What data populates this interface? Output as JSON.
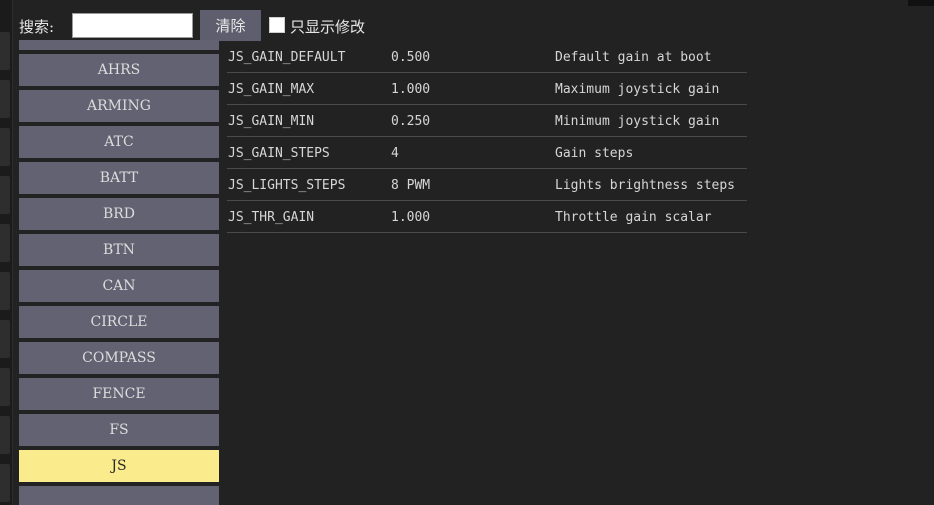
{
  "toolbar": {
    "search_label": "搜索:",
    "search_value": "",
    "clear_label": "清除",
    "only_modified_label": "只显示修改",
    "only_modified_checked": false
  },
  "sidebar": {
    "items": [
      {
        "label": "AHRS",
        "selected": false
      },
      {
        "label": "ARMING",
        "selected": false
      },
      {
        "label": "ATC",
        "selected": false
      },
      {
        "label": "BATT",
        "selected": false
      },
      {
        "label": "BRD",
        "selected": false
      },
      {
        "label": "BTN",
        "selected": false
      },
      {
        "label": "CAN",
        "selected": false
      },
      {
        "label": "CIRCLE",
        "selected": false
      },
      {
        "label": "COMPASS",
        "selected": false
      },
      {
        "label": "FENCE",
        "selected": false
      },
      {
        "label": "FS",
        "selected": false
      },
      {
        "label": "JS",
        "selected": true
      }
    ],
    "selected_accent": "#faeb8c",
    "item_color": "#626272"
  },
  "params": [
    {
      "name": "JS_GAIN_DEFAULT",
      "value": "0.500",
      "description": "Default gain at boot"
    },
    {
      "name": "JS_GAIN_MAX",
      "value": "1.000",
      "description": "Maximum joystick gain"
    },
    {
      "name": "JS_GAIN_MIN",
      "value": "0.250",
      "description": "Minimum joystick gain"
    },
    {
      "name": "JS_GAIN_STEPS",
      "value": "4",
      "description": "Gain steps"
    },
    {
      "name": "JS_LIGHTS_STEPS",
      "value": "8 PWM",
      "description": "Lights brightness steps"
    },
    {
      "name": "JS_THR_GAIN",
      "value": "1.000",
      "description": "Throttle gain scalar"
    }
  ]
}
